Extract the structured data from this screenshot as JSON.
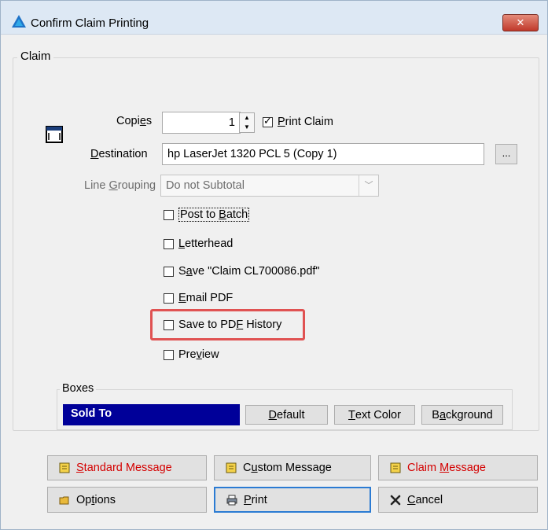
{
  "window": {
    "title": "Confirm Claim Printing",
    "close_glyph": "✕"
  },
  "icons": {
    "app": "app-logo-icon",
    "form": "form-window-icon",
    "note": "note-icon",
    "folder": "folder-icon",
    "printer": "printer-icon",
    "cancel": "x-cancel-icon"
  },
  "colors": {
    "sold_to_bg": "#000099",
    "highlight": "#e05252",
    "red_text": "#d40000"
  },
  "claim": {
    "group_label": "Claim",
    "copies": {
      "label_pre": "Copi",
      "label_u": "e",
      "label_post": "s",
      "value": "1"
    },
    "print_claim": {
      "pre": "",
      "u": "P",
      "post": "rint Claim",
      "checked": true
    },
    "destination": {
      "label_u": "D",
      "label_post": "estination",
      "value": "hp LaserJet 1320 PCL 5 (Copy 1)",
      "browse": "..."
    },
    "line_grouping": {
      "label_pre": "Line ",
      "label_u": "G",
      "label_post": "rouping",
      "value": "Do not Subtotal"
    },
    "options": {
      "post_batch": {
        "pre": "Post to ",
        "u": "B",
        "post": "atch"
      },
      "letterhead": {
        "pre": "",
        "u": "L",
        "post": "etterhead"
      },
      "save_pdf": {
        "pre": "S",
        "u": "a",
        "post": "ve \"Claim CL700086.pdf\""
      },
      "email_pdf": {
        "pre": "",
        "u": "E",
        "post": "mail PDF"
      },
      "save_history": {
        "pre": "Save to PD",
        "u": "F",
        "post": " History"
      },
      "preview": {
        "pre": "Pre",
        "u": "v",
        "post": "iew"
      }
    }
  },
  "boxes": {
    "label": "Boxes",
    "selected": "Sold To",
    "default": {
      "u": "D",
      "post": "efault"
    },
    "text_color": {
      "u": "T",
      "post": "ext Color"
    },
    "background": {
      "pre": "B",
      "u": "a",
      "post": "ckground"
    }
  },
  "buttons": {
    "standard_message": {
      "u": "S",
      "post": "tandard Message"
    },
    "custom_message": {
      "pre": "C",
      "u": "u",
      "post": "stom Message"
    },
    "claim_message": {
      "pre": "Claim ",
      "u": "M",
      "post": "essage"
    },
    "options": {
      "pre": "Op",
      "u": "t",
      "post": "ions"
    },
    "print": {
      "u": "P",
      "post": "rint"
    },
    "cancel": {
      "u": "C",
      "post": "ancel"
    }
  }
}
